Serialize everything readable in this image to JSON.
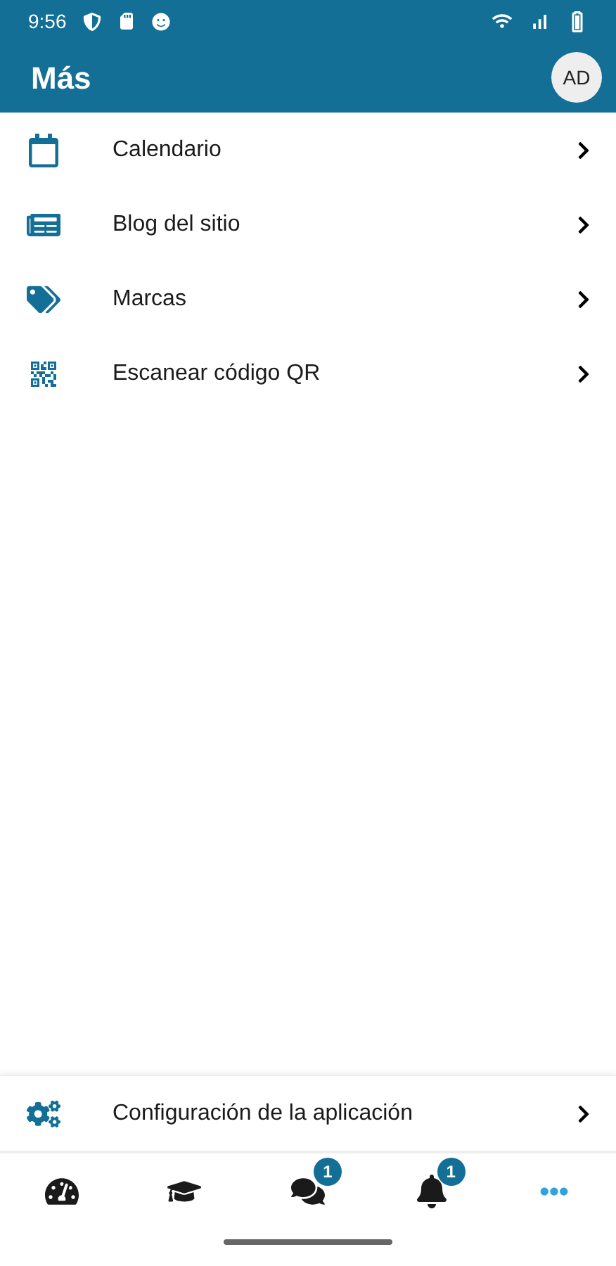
{
  "status_bar": {
    "time": "9:56"
  },
  "app_bar": {
    "title": "Más",
    "avatar": "AD"
  },
  "menu": [
    {
      "label": "Calendario"
    },
    {
      "label": "Blog del sitio"
    },
    {
      "label": "Marcas"
    },
    {
      "label": "Escanear código QR"
    }
  ],
  "footer_item": {
    "label": "Configuración de la aplicación"
  },
  "bottom_nav": [
    {
      "selected": false
    },
    {
      "selected": false
    },
    {
      "selected": false,
      "badge": "1"
    },
    {
      "selected": false,
      "badge": "1"
    },
    {
      "selected": true
    }
  ]
}
